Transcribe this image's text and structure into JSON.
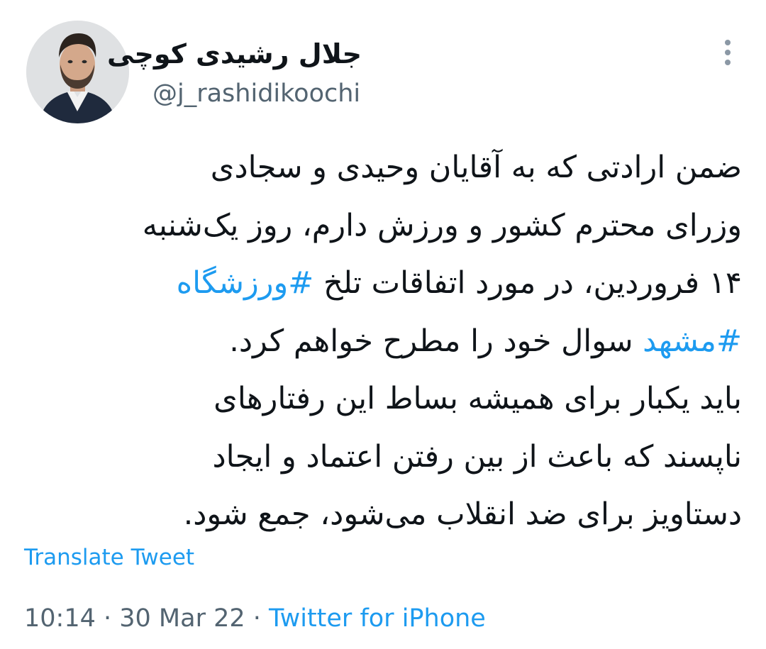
{
  "author": {
    "display_name": "جلال رشیدی کوچی",
    "handle": "@j_rashidikoochi"
  },
  "tweet": {
    "lines": [
      {
        "before": "ضمن ارادتی که به آقایان وحیدی و سجادی",
        "hashtag": "",
        "after": ""
      },
      {
        "before": "وزرای محترم کشور و ورزش دارم، روز یک‌شنبه",
        "hashtag": "",
        "after": ""
      },
      {
        "before": "۱۴ فروردین، در مورد اتفاقات تلخ ",
        "hashtag": "#ورزشگاه",
        "after": ""
      },
      {
        "before": "",
        "hashtag": "#مشهد",
        "after": " سوال خود را مطرح خواهم کرد."
      },
      {
        "before": "باید یکبار برای همیشه بساط این رفتارهای",
        "hashtag": "",
        "after": ""
      },
      {
        "before": "ناپسند که باعث از بین رفتن اعتماد و ایجاد",
        "hashtag": "",
        "after": ""
      },
      {
        "before": "دستاویز برای ضد انقلاب می‌شود، جمع شود.",
        "hashtag": "",
        "after": ""
      }
    ]
  },
  "translate_label": "Translate Tweet",
  "meta": {
    "time": "10:14",
    "separator1": " · ",
    "date": "30 Mar 22",
    "separator2": " · ",
    "source": "Twitter for iPhone"
  },
  "icons": {
    "more": "more-vertical-icon"
  },
  "colors": {
    "link": "#1d9bf0",
    "secondary_text": "#536471",
    "primary_text": "#0f1419"
  }
}
